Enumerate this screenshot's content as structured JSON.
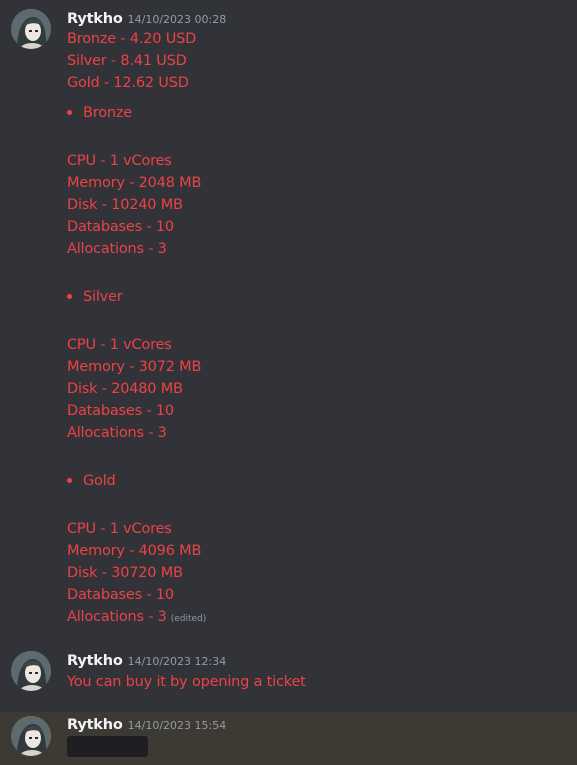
{
  "messages": [
    {
      "author": "Rytkho",
      "timestamp": "14/10/2023 00:28",
      "prices": [
        "Bronze - 4.20 USD",
        "Silver - 8.41 USD",
        "Gold - 12.62 USD"
      ],
      "tiers": [
        {
          "name": "Bronze",
          "specs": [
            "CPU - 1 vCores",
            "Memory - 2048 MB",
            "Disk - 10240 MB",
            "Databases - 10",
            "Allocations - 3"
          ]
        },
        {
          "name": "Silver",
          "specs": [
            "CPU - 1 vCores",
            "Memory - 3072 MB",
            "Disk - 20480 MB",
            "Databases - 10",
            "Allocations - 3"
          ]
        },
        {
          "name": "Gold",
          "specs": [
            "CPU - 1 vCores",
            "Memory - 4096 MB",
            "Disk - 30720 MB",
            "Databases - 10",
            "Allocations - 3"
          ]
        }
      ],
      "edited_label": "(edited)"
    },
    {
      "author": "Rytkho",
      "timestamp": "14/10/2023 12:34",
      "text": "You can buy it by opening a ticket"
    },
    {
      "author": "Rytkho",
      "timestamp": "14/10/2023 15:54",
      "spoiler": true
    }
  ],
  "colors": {
    "background": "#313338",
    "highlight_background": "#3c3a33",
    "author": "#f2f3f5",
    "timestamp": "#949ba4",
    "message_text": "#ed4245",
    "spoiler": "#1e1f22"
  },
  "icons": {
    "avatar": "anime-girl-avatar"
  }
}
